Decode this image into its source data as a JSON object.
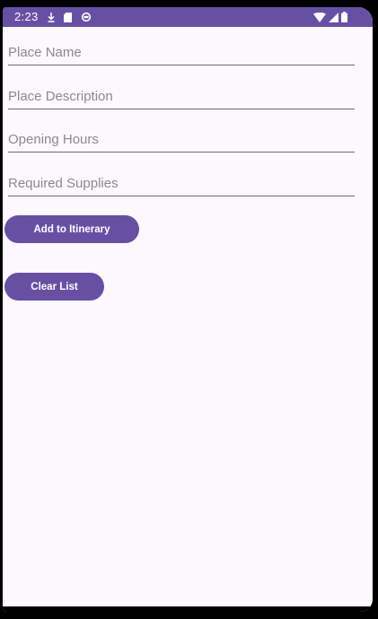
{
  "status_bar": {
    "time": "2:23",
    "background_color": "#6750a4",
    "left_icons": [
      "download-icon",
      "sd-card-icon",
      "sync-icon"
    ],
    "right_icons": [
      "wifi-icon",
      "signal-icon",
      "battery-icon"
    ]
  },
  "form": {
    "place_name": {
      "value": "",
      "placeholder": "Place Name"
    },
    "place_description": {
      "value": "",
      "placeholder": "Place Description"
    },
    "opening_hours": {
      "value": "",
      "placeholder": "Opening Hours"
    },
    "required_supplies": {
      "value": "",
      "placeholder": "Required Supplies"
    }
  },
  "buttons": {
    "add_label": "Add to Itinerary",
    "clear_label": "Clear List"
  },
  "colors": {
    "primary": "#6750a4",
    "surface": "#fdf8fd",
    "underline": "#6b6b6b"
  }
}
